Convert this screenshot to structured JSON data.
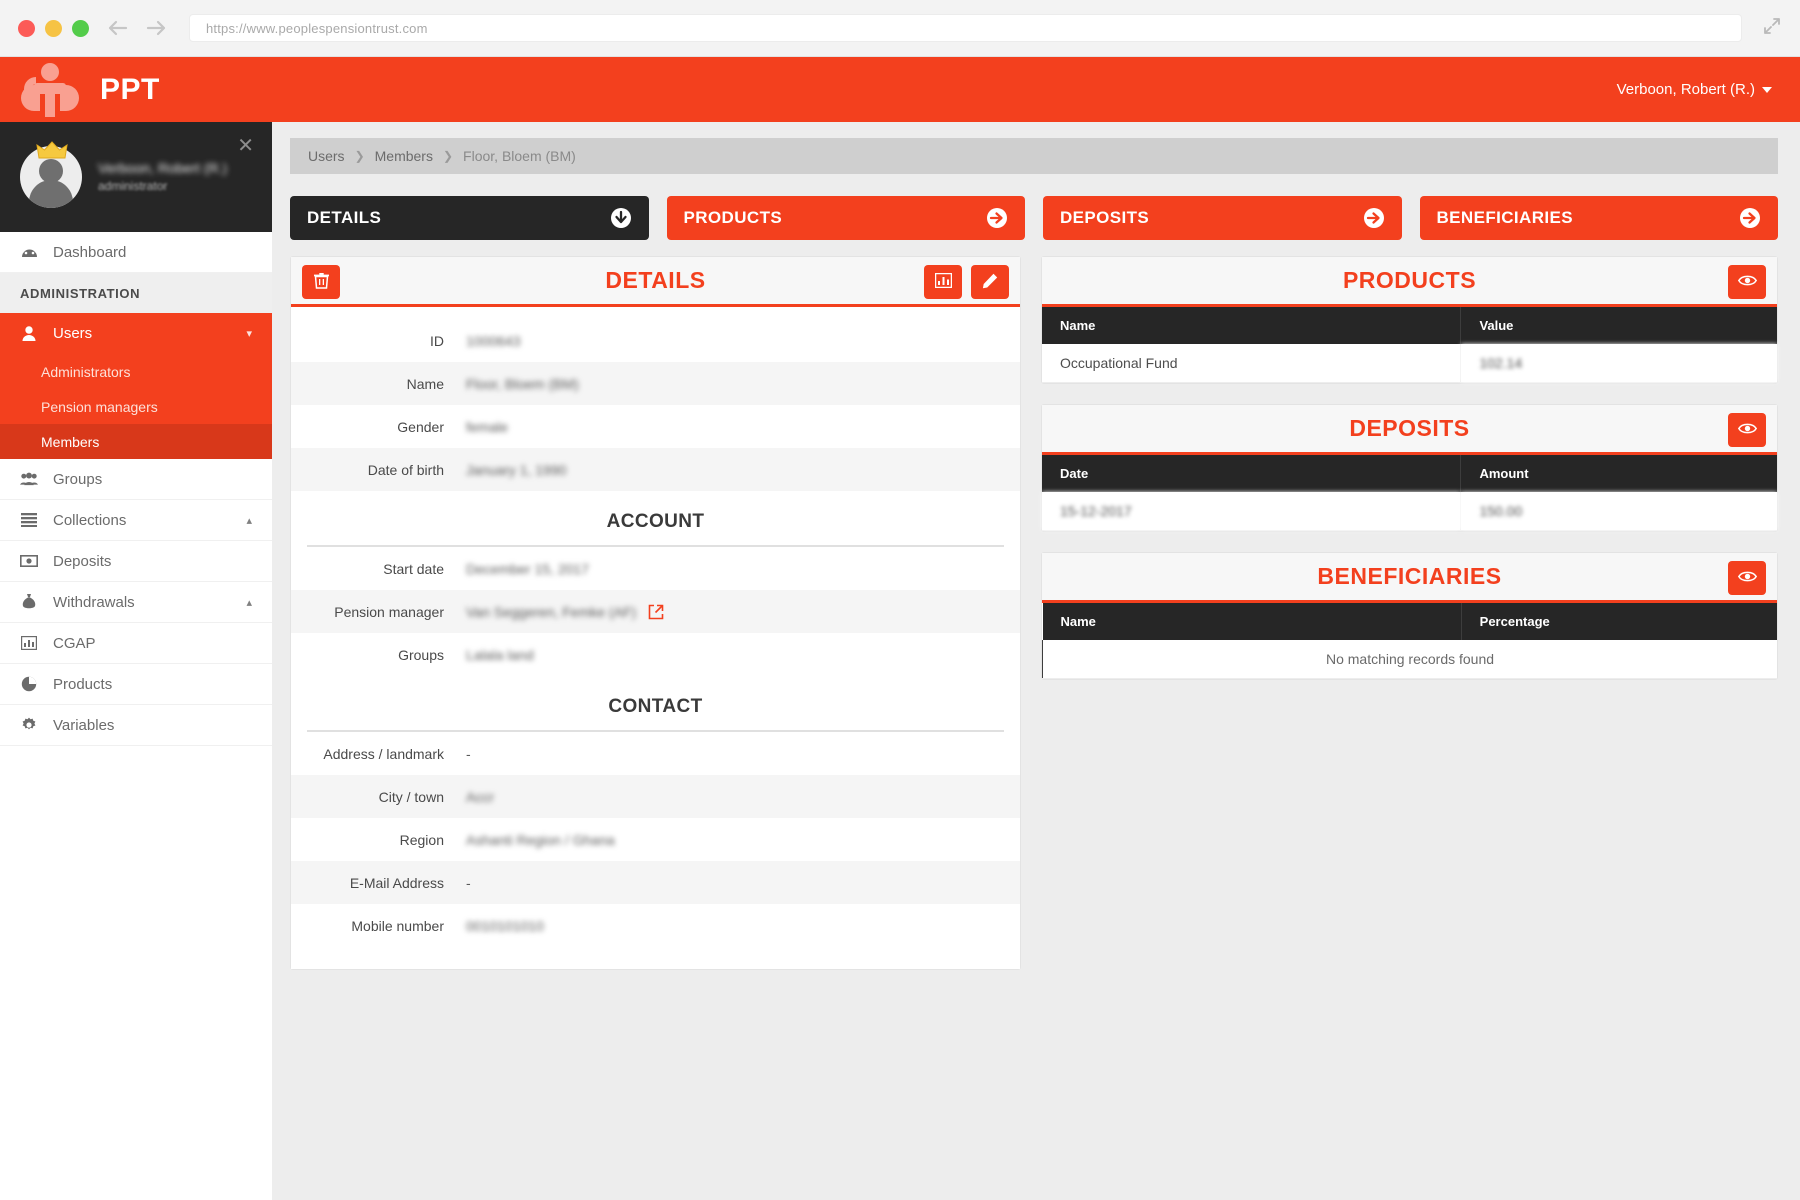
{
  "browser": {
    "url": "https://www.peoplespensiontrust.com",
    "back_icon": "back-arrow-icon",
    "forward_icon": "forward-arrow-icon",
    "expand_icon": "expand-icon"
  },
  "header": {
    "brand": "PPT",
    "logo_icon": "ppt-person-logo-icon",
    "user": "Verboon, Robert (R.)"
  },
  "sidebar": {
    "profile": {
      "name": "Verboon, Robert (R.)",
      "role": "administrator",
      "close_icon": "close-icon",
      "crown_icon": "crown-icon",
      "avatar_icon": "avatar-icon"
    },
    "dashboard": {
      "label": "Dashboard",
      "icon": "dashboard-icon"
    },
    "section": "ADMINISTRATION",
    "users": {
      "label": "Users",
      "icon": "user-icon",
      "chevron": "chevron-down-icon",
      "children": [
        {
          "label": "Administrators"
        },
        {
          "label": "Pension managers"
        },
        {
          "label": "Members"
        }
      ]
    },
    "items": [
      {
        "label": "Groups",
        "icon": "group-icon",
        "chevron": ""
      },
      {
        "label": "Collections",
        "icon": "list-icon",
        "chevron": "chevron-up-icon"
      },
      {
        "label": "Deposits",
        "icon": "money-icon",
        "chevron": ""
      },
      {
        "label": "Withdrawals",
        "icon": "money-bag-icon",
        "chevron": "chevron-up-icon"
      },
      {
        "label": "CGAP",
        "icon": "bar-chart-icon",
        "chevron": ""
      },
      {
        "label": "Products",
        "icon": "pie-chart-icon",
        "chevron": ""
      },
      {
        "label": "Variables",
        "icon": "gear-icon",
        "chevron": ""
      }
    ]
  },
  "breadcrumb": [
    "Users",
    "Members",
    "Floor, Bloem (BM)"
  ],
  "tabs": [
    {
      "label": "DETAILS",
      "icon": "arrow-down-circle-icon",
      "active": true
    },
    {
      "label": "PRODUCTS",
      "icon": "arrow-right-circle-icon",
      "active": false
    },
    {
      "label": "DEPOSITS",
      "icon": "arrow-right-circle-icon",
      "active": false
    },
    {
      "label": "BENEFICIARIES",
      "icon": "arrow-right-circle-icon",
      "active": false
    }
  ],
  "details_card": {
    "title": "DETAILS",
    "delete_icon": "trash-icon",
    "chart_icon": "bar-chart-icon",
    "edit_icon": "pencil-icon",
    "rows": [
      {
        "label": "ID",
        "value": "1000643",
        "blurred": true
      },
      {
        "label": "Name",
        "value": "Floor, Bloem (BM)",
        "blurred": true
      },
      {
        "label": "Gender",
        "value": "female",
        "blurred": true
      },
      {
        "label": "Date of birth",
        "value": "January 1, 1990",
        "blurred": true
      }
    ],
    "account_heading": "ACCOUNT",
    "account_rows": [
      {
        "label": "Start date",
        "value": "December 15, 2017",
        "blurred": true,
        "link": false
      },
      {
        "label": "Pension manager",
        "value": "Van Seggeren, Femke (AF)",
        "blurred": true,
        "link": true,
        "link_icon": "external-link-icon"
      },
      {
        "label": "Groups",
        "value": "Lalala land",
        "blurred": true,
        "link": false
      }
    ],
    "contact_heading": "CONTACT",
    "contact_rows": [
      {
        "label": "Address / landmark",
        "value": "-",
        "blurred": false
      },
      {
        "label": "City / town",
        "value": "Accr",
        "blurred": true
      },
      {
        "label": "Region",
        "value": "Ashanti Region / Ghana",
        "blurred": true
      },
      {
        "label": "E-Mail Address",
        "value": "-",
        "blurred": false
      },
      {
        "label": "Mobile number",
        "value": "0010101010",
        "blurred": true
      }
    ]
  },
  "products_card": {
    "title": "PRODUCTS",
    "view_icon": "eye-icon",
    "columns": [
      "Name",
      "Value"
    ],
    "rows": [
      {
        "name": "Occupational Fund",
        "value": "102.14",
        "value_blurred": true
      }
    ]
  },
  "deposits_card": {
    "title": "DEPOSITS",
    "view_icon": "eye-icon",
    "columns": [
      "Date",
      "Amount"
    ],
    "rows": [
      {
        "date": "15-12-2017",
        "amount": "150.00",
        "blurred": true
      }
    ]
  },
  "beneficiaries_card": {
    "title": "BENEFICIARIES",
    "view_icon": "eye-icon",
    "columns": [
      "Name",
      "Percentage"
    ],
    "empty_text": "No matching records found"
  },
  "colors": {
    "accent": "#f3401e",
    "dark": "#262626",
    "page_bg": "#ededed"
  }
}
